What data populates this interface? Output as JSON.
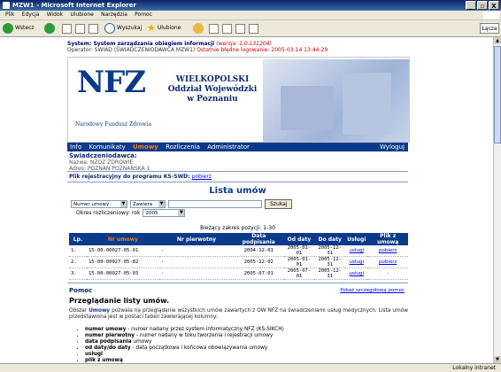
{
  "window": {
    "title": "MZW1 - Microsoft Internet Explorer",
    "buttons": [
      "_",
      "▫",
      "X"
    ]
  },
  "menu": [
    "Plik",
    "Edycja",
    "Widok",
    "Ulubione",
    "Narzędzia",
    "Pomoc"
  ],
  "toolbar": {
    "back": "Wstecz",
    "search": "Wyszukaj",
    "favorites": "Ulubione",
    "links": "Łącza"
  },
  "system": {
    "title": "System: System zarządzania obiegiem informacji",
    "version": "(wersja: 1.0.131204)",
    "operator_label": "Operator: SWIAD (ŚWIADCZENIODAWCA MZW1)",
    "last_login": "Ostatnie błędne logowanie: 2005-03-14 13:44:29"
  },
  "banner": {
    "logo": "NFZ",
    "logo_sub": "Narodowy Fundusz Zdrowia",
    "region_1": "WIELKOPOLSKI",
    "region_2": "Oddział Wojewódzki",
    "region_3": "w Poznaniu"
  },
  "nav": {
    "items": [
      "Info",
      "Komunikaty",
      "Umowy",
      "Rozliczenia",
      "Administrator"
    ],
    "active": "Umowy",
    "logout": "Wyloguj"
  },
  "provider": {
    "heading": "Świadczeniodawca:",
    "name": "Nazwa: NZOZ ZDROWIE",
    "address": "Adres: POZNAŃ POZNAŃSKA 1"
  },
  "ksswd": {
    "label": "Plik rejestracyjny do programu KS-SWD:",
    "link": "pobierz"
  },
  "list": {
    "heading": "Lista umów",
    "search_field": "Numer umowy",
    "search_op": "Zawiera",
    "search_value": "",
    "search_button": "Szukaj",
    "period_label": "Okres rozliczeniowy: rok",
    "period_value": "2005",
    "range": "Bieżący zakres pozycji: 1-30"
  },
  "table": {
    "columns": [
      "Lp.",
      "Nr umowy",
      "Nr pierwotny",
      "Data podpisania",
      "Od daty",
      "Do daty",
      "Usługi",
      "Plik z umową"
    ],
    "rows": [
      [
        "1.",
        "15-00-00027-05-01",
        "-",
        "2004-12-01",
        "2005-01-01",
        "2005-12-31",
        "usługi",
        "pobierz"
      ],
      [
        "2.",
        "15-00-00027-05-02",
        "-",
        "2005-12-02",
        "2005-01-01",
        "2005-12-31",
        "usługi",
        "pobierz"
      ],
      [
        "3.",
        "15-00-00027-05-03",
        "-",
        "2005-07-01",
        "2005-07-01",
        "2005-12-31",
        "usługi",
        "-"
      ]
    ]
  },
  "help": {
    "title": "Pomoc",
    "full_link": "Pokaż szczegółową pomoc",
    "subtitle": "Przeglądanie listy umów.",
    "text_prefix": "Obszar",
    "text_bold": "Umowy",
    "text_rest": "pozwala na przeglądanie wszystkich umów zawartych z OW NFZ na świadczeniami usług medycznych. Lista umów przedstawiona jest w postaci tabeli zawierającej kolumny:",
    "fields": [
      {
        "name": "numer umowy",
        "desc": "- numer nadany przez system informatyczny NFZ (KS-SIKCH)"
      },
      {
        "name": "numer pierwotny",
        "desc": "- numer nadany w toku tworzenia i rejestracji umowy"
      },
      {
        "name": "data podpisania",
        "desc": "umowy"
      },
      {
        "name": "od daty/do daty",
        "desc": "- data początkowa i końcowa obowiązywania umowy"
      },
      {
        "name": "usługi",
        "desc": ""
      },
      {
        "name": "plik z umową",
        "desc": ""
      }
    ]
  },
  "status": {
    "zone": "Lokalny intranet"
  }
}
